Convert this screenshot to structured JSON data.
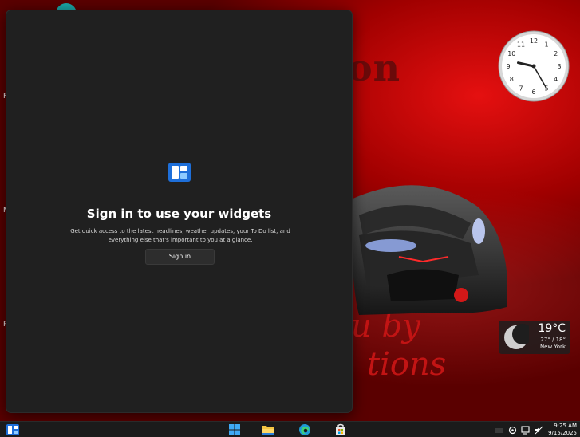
{
  "wallpaper": {
    "text_top": "on",
    "text_bottom_line1": "u by",
    "text_bottom_line2": "tions",
    "left_glyphs": [
      "F",
      "M",
      "R"
    ]
  },
  "clock": {
    "numbers": [
      "12",
      "1",
      "2",
      "3",
      "4",
      "5",
      "6",
      "7",
      "8",
      "9",
      "10",
      "11"
    ],
    "hour": 9,
    "minute": 25
  },
  "weather": {
    "temp": "19°C",
    "range": "27° / 18°",
    "city": "New York",
    "icon": "moon-icon"
  },
  "widgets_panel": {
    "title": "Sign in to use your widgets",
    "description": "Get quick access to the latest headlines, weather updates, your To Do list, and everything else that's important to you at a glance.",
    "signin_label": "Sign in",
    "logo_icon": "widgets-icon"
  },
  "taskbar": {
    "icons": [
      "widgets-icon",
      "start-icon",
      "file-explorer-icon",
      "edge-icon",
      "store-icon"
    ],
    "tray_icons": [
      "keyboard-icon",
      "network-icon",
      "display-icon",
      "volume-mute-icon"
    ],
    "time": "9:25 AM",
    "date": "9/15/2025"
  },
  "colors": {
    "panel_bg": "#202020",
    "wallpaper_red": "#c00000",
    "accent_blue": "#0a84ff"
  }
}
